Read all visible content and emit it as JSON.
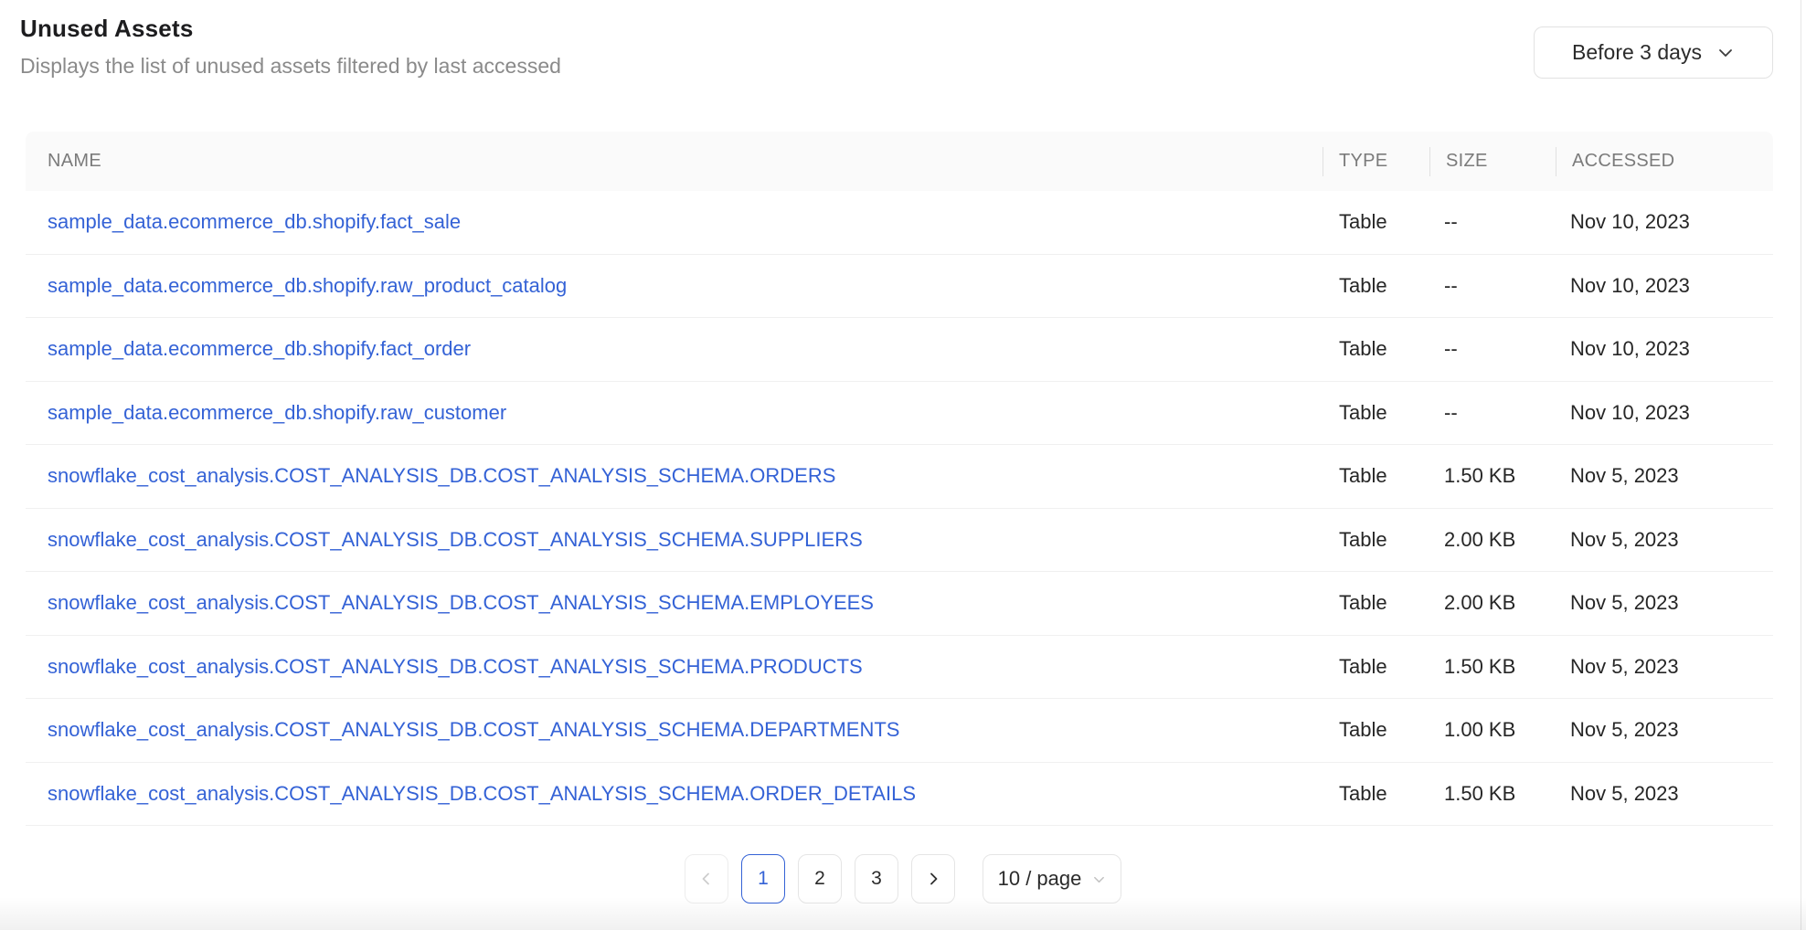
{
  "header": {
    "title": "Unused Assets",
    "subtitle": "Displays the list of unused assets filtered by last accessed"
  },
  "filter_dropdown": {
    "value": "Before 3 days",
    "icon": "chevron-down-icon"
  },
  "table": {
    "columns": {
      "name": "NAME",
      "type": "TYPE",
      "size": "SIZE",
      "accessed": "ACCESSED"
    },
    "rows": [
      {
        "name": "sample_data.ecommerce_db.shopify.fact_sale",
        "type": "Table",
        "size": "--",
        "accessed": "Nov 10, 2023"
      },
      {
        "name": "sample_data.ecommerce_db.shopify.raw_product_catalog",
        "type": "Table",
        "size": "--",
        "accessed": "Nov 10, 2023"
      },
      {
        "name": "sample_data.ecommerce_db.shopify.fact_order",
        "type": "Table",
        "size": "--",
        "accessed": "Nov 10, 2023"
      },
      {
        "name": "sample_data.ecommerce_db.shopify.raw_customer",
        "type": "Table",
        "size": "--",
        "accessed": "Nov 10, 2023"
      },
      {
        "name": "snowflake_cost_analysis.COST_ANALYSIS_DB.COST_ANALYSIS_SCHEMA.ORDERS",
        "type": "Table",
        "size": "1.50 KB",
        "accessed": "Nov 5, 2023"
      },
      {
        "name": "snowflake_cost_analysis.COST_ANALYSIS_DB.COST_ANALYSIS_SCHEMA.SUPPLIERS",
        "type": "Table",
        "size": "2.00 KB",
        "accessed": "Nov 5, 2023"
      },
      {
        "name": "snowflake_cost_analysis.COST_ANALYSIS_DB.COST_ANALYSIS_SCHEMA.EMPLOYEES",
        "type": "Table",
        "size": "2.00 KB",
        "accessed": "Nov 5, 2023"
      },
      {
        "name": "snowflake_cost_analysis.COST_ANALYSIS_DB.COST_ANALYSIS_SCHEMA.PRODUCTS",
        "type": "Table",
        "size": "1.50 KB",
        "accessed": "Nov 5, 2023"
      },
      {
        "name": "snowflake_cost_analysis.COST_ANALYSIS_DB.COST_ANALYSIS_SCHEMA.DEPARTMENTS",
        "type": "Table",
        "size": "1.00 KB",
        "accessed": "Nov 5, 2023"
      },
      {
        "name": "snowflake_cost_analysis.COST_ANALYSIS_DB.COST_ANALYSIS_SCHEMA.ORDER_DETAILS",
        "type": "Table",
        "size": "1.50 KB",
        "accessed": "Nov 5, 2023"
      }
    ]
  },
  "pagination": {
    "prev_icon": "chevron-left-icon",
    "next_icon": "chevron-right-icon",
    "pages": [
      "1",
      "2",
      "3"
    ],
    "active_page": "1",
    "page_size": "10 / page",
    "page_size_icon": "chevron-down-icon"
  },
  "colors": {
    "link": "#3462d6",
    "accent": "#3462d6",
    "header_background": "#fafafa",
    "row_divider": "#f0f0f0",
    "muted_text": "#8a8a8a"
  }
}
